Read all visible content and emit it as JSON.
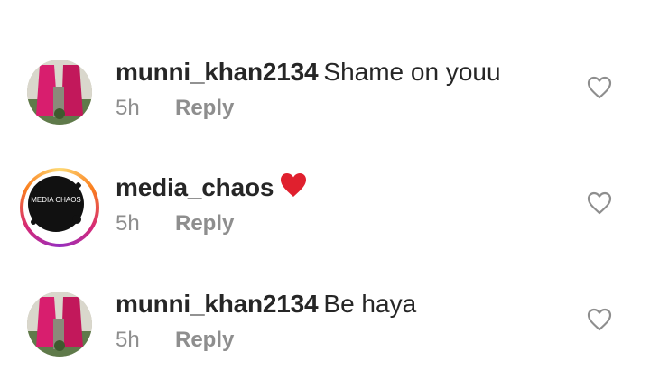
{
  "comments": [
    {
      "username": "munni_khan2134",
      "text": "Shame on youu",
      "time": "5h",
      "reply_label": "Reply",
      "avatar": "pink-outfit-photo",
      "has_story_ring": false
    },
    {
      "username": "media_chaos",
      "text": "",
      "emoji": "red-heart",
      "time": "5h",
      "reply_label": "Reply",
      "avatar": "media-chaos-logo",
      "avatar_text": "MEDIA CHAOS",
      "has_story_ring": true
    },
    {
      "username": "munni_khan2134",
      "text": "Be haya",
      "time": "5h",
      "reply_label": "Reply",
      "avatar": "pink-outfit-photo",
      "has_story_ring": false
    }
  ],
  "colors": {
    "username": "#262626",
    "meta": "#8e8e8e",
    "heart_emoji": "#e0202e",
    "like_icon": "#8e8e8e"
  }
}
